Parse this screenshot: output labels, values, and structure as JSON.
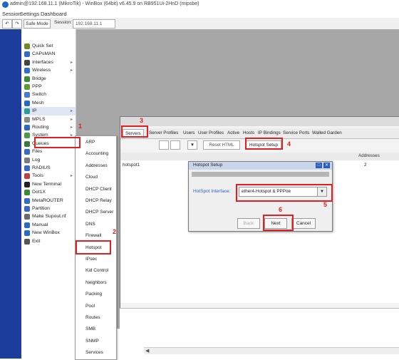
{
  "window": {
    "title": "admin@192.168.11.1 (MikroTik) - WinBox (64bit) v6.45.9 on RB951Ui-2HnD (mipsbe)"
  },
  "menubar": {
    "items": [
      "Session",
      "Settings",
      "Dashboard"
    ]
  },
  "toolbar": {
    "undo": "↶",
    "redo": "↷",
    "safe_mode": "Safe Mode",
    "session_label": "Session:",
    "session_value": "192.168.11.1"
  },
  "sidebar": {
    "items": [
      {
        "label": "Quick Set",
        "icon": "quick-set-icon",
        "color": "#6a8a2a"
      },
      {
        "label": "CAPsMAN",
        "icon": "capsman-icon",
        "color": "#3a6bc4"
      },
      {
        "label": "Interfaces",
        "icon": "interfaces-icon",
        "color": "#444444"
      },
      {
        "label": "Wireless",
        "icon": "wireless-icon",
        "color": "#2f6fd0"
      },
      {
        "label": "Bridge",
        "icon": "bridge-icon",
        "color": "#3c8a3c"
      },
      {
        "label": "PPP",
        "icon": "ppp-icon",
        "color": "#5a9a3a"
      },
      {
        "label": "Switch",
        "icon": "switch-icon",
        "color": "#4a7ad0"
      },
      {
        "label": "Mesh",
        "icon": "mesh-icon",
        "color": "#2a6ac0"
      },
      {
        "label": "IP",
        "icon": "ip-icon",
        "color": "#2a9a9a"
      },
      {
        "label": "MPLS",
        "icon": "mpls-icon",
        "color": "#8a8a8a"
      },
      {
        "label": "Routing",
        "icon": "routing-icon",
        "color": "#2a6ac0"
      },
      {
        "label": "System",
        "icon": "system-icon",
        "color": "#4a9a4a"
      },
      {
        "label": "Queues",
        "icon": "queues-icon",
        "color": "#3a7a3a"
      },
      {
        "label": "Files",
        "icon": "files-icon",
        "color": "#3a6ac0"
      },
      {
        "label": "Log",
        "icon": "log-icon",
        "color": "#7a7a7a"
      },
      {
        "label": "RADIUS",
        "icon": "radius-icon",
        "color": "#3a6ac0"
      },
      {
        "label": "Tools",
        "icon": "tools-icon",
        "color": "#c04040"
      },
      {
        "label": "New Terminal",
        "icon": "terminal-icon",
        "color": "#222222"
      },
      {
        "label": "Dot1X",
        "icon": "dot1x-icon",
        "color": "#3a8a3a"
      },
      {
        "label": "MetaROUTER",
        "icon": "metarouter-icon",
        "color": "#3a6ac0"
      },
      {
        "label": "Partition",
        "icon": "partition-icon",
        "color": "#3a6ac0"
      },
      {
        "label": "Make Supout.rif",
        "icon": "supout-icon",
        "color": "#6a6a6a"
      },
      {
        "label": "Manual",
        "icon": "manual-icon",
        "color": "#2a6ac0"
      },
      {
        "label": "New WinBox",
        "icon": "winbox-icon",
        "color": "#2a6ac0"
      },
      {
        "label": "Exit",
        "icon": "exit-icon",
        "color": "#555555"
      }
    ]
  },
  "ip_submenu": {
    "items": [
      "ARP",
      "Accounting",
      "Addresses",
      "Cloud",
      "DHCP Client",
      "DHCP Relay",
      "DHCP Server",
      "DNS",
      "Firewall",
      "Hotspot",
      "IPsec",
      "Kid Control",
      "Neighbors",
      "Packing",
      "Pool",
      "Routes",
      "SMB",
      "SNMP",
      "Services"
    ]
  },
  "hotspot_window": {
    "title": "",
    "tabs": [
      "Servers",
      "Server Profiles",
      "Users",
      "User Profiles",
      "Active",
      "Hosts",
      "IP Bindings",
      "Service Ports",
      "Walled Garden"
    ],
    "reset_html_label": "Reset HTML",
    "hotspot_setup_label": "Hotspot Setup",
    "columns": [
      "",
      "Addresses"
    ],
    "row": {
      "name": "hotspot1",
      "addresses": "2"
    }
  },
  "dialog": {
    "title": "Hotspot Setup",
    "subtitle": "",
    "field_label": "HotSpot Interface:",
    "field_value": "ether4-Hotspot & PPPoe",
    "back": "Back",
    "next": "Next",
    "cancel": "Cancel"
  },
  "annotations": [
    "1",
    "2",
    "3",
    "4",
    "5",
    "6"
  ]
}
